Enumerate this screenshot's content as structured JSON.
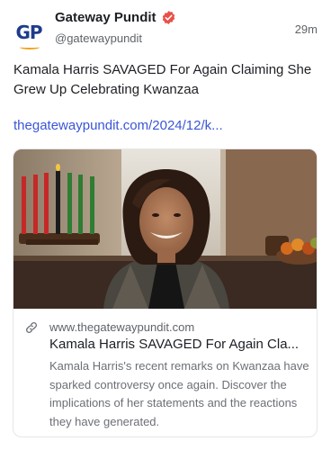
{
  "author": {
    "name": "Gateway Pundit",
    "handle": "@gatewaypundit",
    "avatar_text": "GP",
    "verified": true,
    "verified_icon": "verified-badge-icon",
    "verified_color": "#e8504a"
  },
  "timestamp": "29m",
  "post": {
    "text": "Kamala Harris SAVAGED For Again Claiming She Grew Up Celebrating Kwanzaa",
    "link_text": "thegatewaypundit.com/2024/12/k..."
  },
  "card": {
    "link_icon": "link-icon",
    "domain": "www.thegatewaypundit.com",
    "title": "Kamala Harris SAVAGED For Again Cla...",
    "description": "Kamala Harris's recent remarks on Kwanzaa have sparked controversy once again. Discover the implications of her statements and the reactions they have generated."
  },
  "colors": {
    "link": "#3b56d6",
    "brand_blue": "#1e3c8c",
    "brand_orange": "#f2a21a"
  }
}
